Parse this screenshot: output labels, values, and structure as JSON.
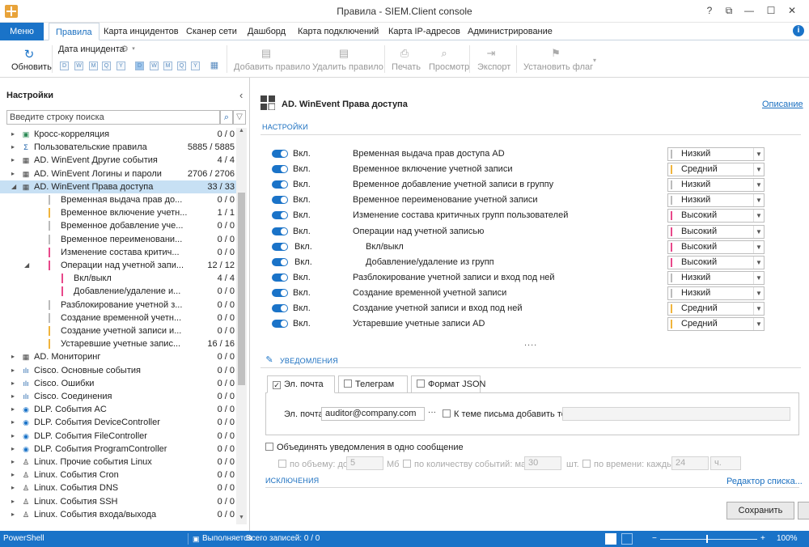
{
  "window": {
    "title": "Правила - SIEM.Client console",
    "buttons": [
      "?",
      "⧉",
      "—",
      "☐",
      "✕"
    ]
  },
  "ribbon_tabs": {
    "menu": "Меню",
    "tabs": [
      "Правила",
      "Карта инцидентов",
      "Сканер сети",
      "Дашборд",
      "Карта подключений",
      "Карта IP-адресов",
      "Администрирование"
    ],
    "active": "Правила"
  },
  "ribbon": {
    "refresh": "Обновить",
    "incident_date": "Дата инцидента",
    "date_buttons": [
      "D",
      "W",
      "M",
      "Q",
      "Y",
      "D",
      "W",
      "M",
      "Q",
      "Y"
    ],
    "add_rule": "Добавить правило",
    "delete_rule": "Удалить правило",
    "print": "Печать",
    "preview": "Просмотр",
    "export": "Экспорт",
    "set_flag": "Установить флаг"
  },
  "left": {
    "header": "Настройки",
    "search_placeholder": "Введите строку поиска",
    "tree": [
      {
        "label": "Кросс-корреляция",
        "count": "0 / 0",
        "level": 0,
        "arrow": "▸",
        "icon": "▣",
        "icon_color": "#2e8b57"
      },
      {
        "label": "Пользовательские правила",
        "count": "5885 / 5885",
        "level": 0,
        "arrow": "▸",
        "icon": "Σ",
        "icon_color": "#1a5fa8"
      },
      {
        "label": "AD. WinEvent Другие события",
        "count": "4 / 4",
        "level": 0,
        "arrow": "▸",
        "icon": "▦",
        "icon_color": "#444"
      },
      {
        "label": "AD. WinEvent Логины и пароли",
        "count": "2706 / 2706",
        "level": 0,
        "arrow": "▸",
        "icon": "▦",
        "icon_color": "#444"
      },
      {
        "label": "AD. WinEvent Права доступа",
        "count": "33 / 33",
        "level": 0,
        "arrow": "◢",
        "icon": "▦",
        "icon_color": "#444",
        "selected": true
      },
      {
        "label": "Временная выдача прав до...",
        "count": "0 / 0",
        "level": 1,
        "sev": "#bbbbbb"
      },
      {
        "label": "Временное включение учетн...",
        "count": "1 / 1",
        "level": 1,
        "sev": "#f0b43c"
      },
      {
        "label": "Временное добавление учe...",
        "count": "0 / 0",
        "level": 1,
        "sev": "#bbbbbb"
      },
      {
        "label": "Временное переименовани...",
        "count": "0 / 0",
        "level": 1,
        "sev": "#bbbbbb"
      },
      {
        "label": "Изменение состава критич...",
        "count": "0 / 0",
        "level": 1,
        "sev": "#e8488a"
      },
      {
        "label": "Операции над учетной запи...",
        "count": "12 / 12",
        "level": 1,
        "sev": "#e8488a",
        "arrow": "◢"
      },
      {
        "label": "Вкл/выкл",
        "count": "4 / 4",
        "level": 2,
        "sev": "#e8488a"
      },
      {
        "label": "Добавление/удаление и...",
        "count": "0 / 0",
        "level": 2,
        "sev": "#e8488a"
      },
      {
        "label": "Разблокирование учетной з...",
        "count": "0 / 0",
        "level": 1,
        "sev": "#bbbbbb"
      },
      {
        "label": "Создание временной учетн...",
        "count": "0 / 0",
        "level": 1,
        "sev": "#bbbbbb"
      },
      {
        "label": "Создание учетной записи и...",
        "count": "0 / 0",
        "level": 1,
        "sev": "#f0b43c"
      },
      {
        "label": "Устаревшие учетные запис...",
        "count": "16 / 16",
        "level": 1,
        "sev": "#f0b43c"
      },
      {
        "label": "AD. Мониторинг",
        "count": "0 / 0",
        "level": 0,
        "arrow": "▸",
        "icon": "▦",
        "icon_color": "#444"
      },
      {
        "label": "Cisco. Основные события",
        "count": "0 / 0",
        "level": 0,
        "arrow": "▸",
        "icon": "ılı",
        "icon_color": "#1a5fa8"
      },
      {
        "label": "Cisco. Ошибки",
        "count": "0 / 0",
        "level": 0,
        "arrow": "▸",
        "icon": "ılı",
        "icon_color": "#1a5fa8"
      },
      {
        "label": "Cisco. Соединения",
        "count": "0 / 0",
        "level": 0,
        "arrow": "▸",
        "icon": "ılı",
        "icon_color": "#1a5fa8"
      },
      {
        "label": "DLP. События AC",
        "count": "0 / 0",
        "level": 0,
        "arrow": "▸",
        "icon": "◉",
        "icon_color": "#1a73c8"
      },
      {
        "label": "DLP. События DeviceController",
        "count": "0 / 0",
        "level": 0,
        "arrow": "▸",
        "icon": "◉",
        "icon_color": "#1a73c8"
      },
      {
        "label": "DLP. События FileController",
        "count": "0 / 0",
        "level": 0,
        "arrow": "▸",
        "icon": "◉",
        "icon_color": "#1a73c8"
      },
      {
        "label": "DLP. События ProgramController",
        "count": "0 / 0",
        "level": 0,
        "arrow": "▸",
        "icon": "◉",
        "icon_color": "#1a73c8"
      },
      {
        "label": "Linux. Прочие события Linux",
        "count": "0 / 0",
        "level": 0,
        "arrow": "▸",
        "icon": "♙",
        "icon_color": "#222"
      },
      {
        "label": "Linux. События Cron",
        "count": "0 / 0",
        "level": 0,
        "arrow": "▸",
        "icon": "♙",
        "icon_color": "#222"
      },
      {
        "label": "Linux. События DNS",
        "count": "0 / 0",
        "level": 0,
        "arrow": "▸",
        "icon": "♙",
        "icon_color": "#222"
      },
      {
        "label": "Linux. События SSH",
        "count": "0 / 0",
        "level": 0,
        "arrow": "▸",
        "icon": "♙",
        "icon_color": "#222"
      },
      {
        "label": "Linux. События входа/выхода",
        "count": "0 / 0",
        "level": 0,
        "arrow": "▸",
        "icon": "♙",
        "icon_color": "#222"
      }
    ]
  },
  "right": {
    "title": "AD. WinEvent Права доступа",
    "description_link": "Описание",
    "settings_header": "НАСТРОЙКИ",
    "on_label": "Вкл.",
    "rules": [
      {
        "name": "Временная выдача прав доступа AD",
        "severity": "Низкий",
        "sev_color": "#bbbbbb",
        "indent": 0
      },
      {
        "name": "Временное включение учетной записи",
        "severity": "Средний",
        "sev_color": "#f0b43c",
        "indent": 0
      },
      {
        "name": "Временное добавление учетной записи в группу",
        "severity": "Низкий",
        "sev_color": "#bbbbbb",
        "indent": 0
      },
      {
        "name": "Временное переименование учетной записи",
        "severity": "Низкий",
        "sev_color": "#bbbbbb",
        "indent": 0
      },
      {
        "name": "Изменение состава критичных групп пользователей",
        "severity": "Высокий",
        "sev_color": "#e8488a",
        "indent": 0
      },
      {
        "name": "Операции над учетной записью",
        "severity": "Высокий",
        "sev_color": "#e8488a",
        "indent": 0
      },
      {
        "name": "Вкл/выкл",
        "severity": "Высокий",
        "sev_color": "#e8488a",
        "indent": 1
      },
      {
        "name": "Добавление/удаление из групп",
        "severity": "Высокий",
        "sev_color": "#e8488a",
        "indent": 1
      },
      {
        "name": "Разблокирование учетной записи и вход под ней",
        "severity": "Низкий",
        "sev_color": "#bbbbbb",
        "indent": 0
      },
      {
        "name": "Создание временной учетной записи",
        "severity": "Низкий",
        "sev_color": "#bbbbbb",
        "indent": 0
      },
      {
        "name": "Создание учетной записи и вход под ней",
        "severity": "Средний",
        "sev_color": "#f0b43c",
        "indent": 0
      },
      {
        "name": "Устаревшие учетные записи AD",
        "severity": "Средний",
        "sev_color": "#f0b43c",
        "indent": 0
      }
    ],
    "more": "....",
    "notifications_header": "УВЕДОМЛЕНИЯ",
    "notif_tabs": [
      {
        "label": "Эл. почта",
        "checked": true
      },
      {
        "label": "Телеграм",
        "checked": false
      },
      {
        "label": "Формат JSON",
        "checked": false
      }
    ],
    "email_label": "Эл. почта",
    "email_value": "auditor@company.com",
    "email_more": "···",
    "subject_tag_label": "К теме письма добавить тег:",
    "combine_label": "Объединять уведомления в одно сообщение",
    "by_size_label": "по объему: до",
    "by_size_value": "5",
    "by_size_unit": "Мб",
    "by_count_label": "по количеству событий: макс",
    "by_count_value": "30",
    "by_count_unit": "шт.",
    "by_time_label": "по времени: каждые",
    "by_time_value": "24",
    "by_time_unit": "ч.",
    "exceptions_header": "ИСКЛЮЧЕНИЯ",
    "list_editor": "Редактор списка...",
    "save": "Сохранить"
  },
  "statusbar": {
    "left": "PowerShell",
    "running": "Выполняется",
    "total": "Всего записей: 0 / 0",
    "zoom": "100%"
  }
}
